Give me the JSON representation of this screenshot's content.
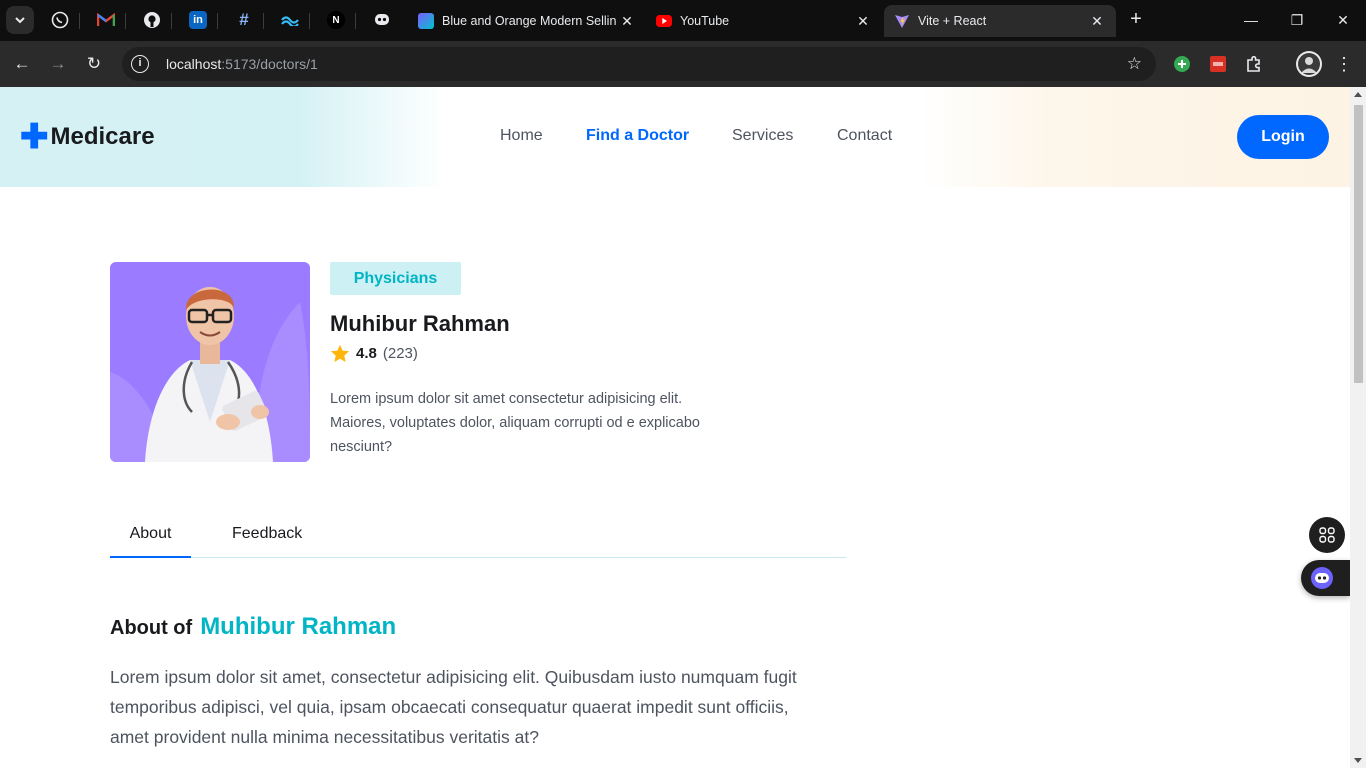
{
  "browser": {
    "tabs": [
      {
        "title": "Blue and Orange Modern Sellin",
        "close": "✕"
      },
      {
        "title": "YouTube",
        "close": "✕"
      },
      {
        "title": "Vite + React",
        "close": "✕"
      }
    ],
    "pinned": [
      "whatsapp-icon",
      "gmail-icon",
      "github-icon",
      "linkedin-icon",
      "hashtag-icon",
      "tailwind-icon",
      "next-icon",
      "chatbot-icon"
    ],
    "new_tab": "+",
    "window_controls": {
      "minimize": "—",
      "restore": "❐",
      "close": "✕"
    },
    "nav": {
      "back": "←",
      "forward": "→",
      "reload": "↻"
    },
    "address": {
      "host": "localhost",
      "path": ":5173/doctors/1"
    },
    "bookmark": "☆",
    "menu": "⋮"
  },
  "header": {
    "logo_plus": "✚",
    "logo_text": "Medicare",
    "nav": [
      "Home",
      "Find a Doctor",
      "Services",
      "Contact"
    ],
    "active_nav": "Find a Doctor",
    "login_label": "Login"
  },
  "doctor": {
    "specialty": "Physicians",
    "name": "Muhibur Rahman",
    "rating": "4.8",
    "rating_count": "(223)",
    "short_bio": "Lorem ipsum dolor sit amet consectetur adipisicing elit. Maiores, voluptates dolor, aliquam corrupti od e explicabo nesciunt?"
  },
  "tabs": {
    "about": "About",
    "feedback": "Feedback",
    "active": "About"
  },
  "about": {
    "heading": "About of",
    "name": "Muhibur Rahman",
    "text": "Lorem ipsum dolor sit amet, consectetur adipisicing elit. Quibusdam iusto numquam fugit temporibus adipisci, vel quia, ipsam obcaecati consequatur quaerat impedit sunt officiis, amet provident nulla minima necessitatibus veritatis at?"
  },
  "colors": {
    "primary": "#0067ff",
    "accent": "#01b5c5",
    "heading": "#181a1e",
    "text": "#4e545f",
    "star": "#feb60d"
  }
}
